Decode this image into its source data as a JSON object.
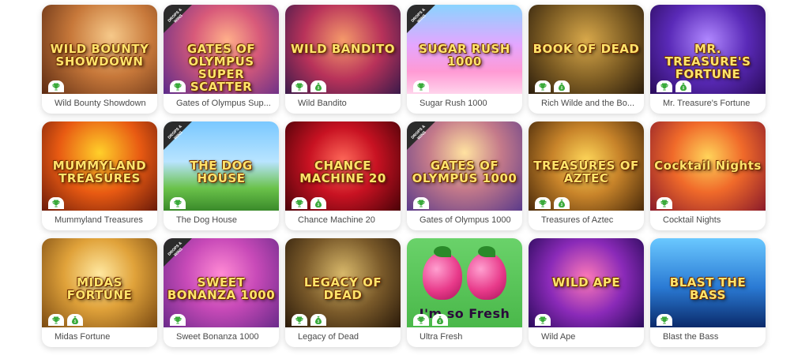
{
  "colors": {
    "card_bg": "#ffffff",
    "label_text": "#4a4a4a",
    "badge_icon": "#3aaa3a"
  },
  "ribbon_text": "DROPS & WINS",
  "games": [
    {
      "name": "Wild Bounty Showdown",
      "art_title": "WILD BOUNTY SHOWDOWN",
      "badges": [
        "trophy-icon"
      ],
      "ribbon": false
    },
    {
      "name": "Gates of Olympus Sup...",
      "art_title": "GATES OF OLYMPUS SUPER SCATTER",
      "badges": [
        "trophy-icon"
      ],
      "ribbon": true
    },
    {
      "name": "Wild Bandito",
      "art_title": "WILD BANDITO",
      "badges": [
        "trophy-icon",
        "money-bag-icon"
      ],
      "ribbon": false
    },
    {
      "name": "Sugar Rush 1000",
      "art_title": "SUGAR RUSH 1000",
      "badges": [
        "trophy-icon"
      ],
      "ribbon": true
    },
    {
      "name": "Rich Wilde and the Bo...",
      "art_title": "BOOK OF DEAD",
      "badges": [
        "trophy-icon",
        "money-bag-icon"
      ],
      "ribbon": false
    },
    {
      "name": "Mr. Treasure's Fortune",
      "art_title": "MR. TREASURE'S FORTUNE",
      "badges": [
        "trophy-icon",
        "money-bag-icon"
      ],
      "ribbon": false
    },
    {
      "name": "Mummyland Treasures",
      "art_title": "MUMMYLAND TREASURES",
      "badges": [
        "trophy-icon"
      ],
      "ribbon": false
    },
    {
      "name": "The Dog House",
      "art_title": "THE DOG HOUSE",
      "badges": [
        "trophy-icon"
      ],
      "ribbon": true
    },
    {
      "name": "Chance Machine 20",
      "art_title": "CHANCE MACHINE 20",
      "badges": [
        "trophy-icon",
        "money-bag-icon"
      ],
      "ribbon": false
    },
    {
      "name": "Gates of Olympus 1000",
      "art_title": "GATES OF OLYMPUS 1000",
      "badges": [
        "trophy-icon"
      ],
      "ribbon": true
    },
    {
      "name": "Treasures of Aztec",
      "art_title": "TREASURES OF AZTEC",
      "badges": [
        "trophy-icon",
        "money-bag-icon"
      ],
      "ribbon": false
    },
    {
      "name": "Cocktail Nights",
      "art_title": "Cocktail Nights",
      "badges": [
        "trophy-icon"
      ],
      "ribbon": false
    },
    {
      "name": "Midas Fortune",
      "art_title": "MIDAS FORTUNE",
      "badges": [
        "trophy-icon",
        "money-bag-icon"
      ],
      "ribbon": false
    },
    {
      "name": "Sweet Bonanza 1000",
      "art_title": "SWEET BONANZA 1000",
      "badges": [
        "trophy-icon"
      ],
      "ribbon": true
    },
    {
      "name": "Legacy of Dead",
      "art_title": "LEGACY OF DEAD",
      "badges": [
        "trophy-icon",
        "money-bag-icon"
      ],
      "ribbon": false
    },
    {
      "name": "Ultra Fresh",
      "art_title": "I'm so Fresh",
      "badges": [
        "trophy-icon",
        "money-bag-icon"
      ],
      "ribbon": false
    },
    {
      "name": "Wild Ape",
      "art_title": "WILD APE",
      "badges": [
        "trophy-icon"
      ],
      "ribbon": false
    },
    {
      "name": "Blast the Bass",
      "art_title": "BLAST THE BASS",
      "badges": [
        "trophy-icon"
      ],
      "ribbon": false
    }
  ]
}
